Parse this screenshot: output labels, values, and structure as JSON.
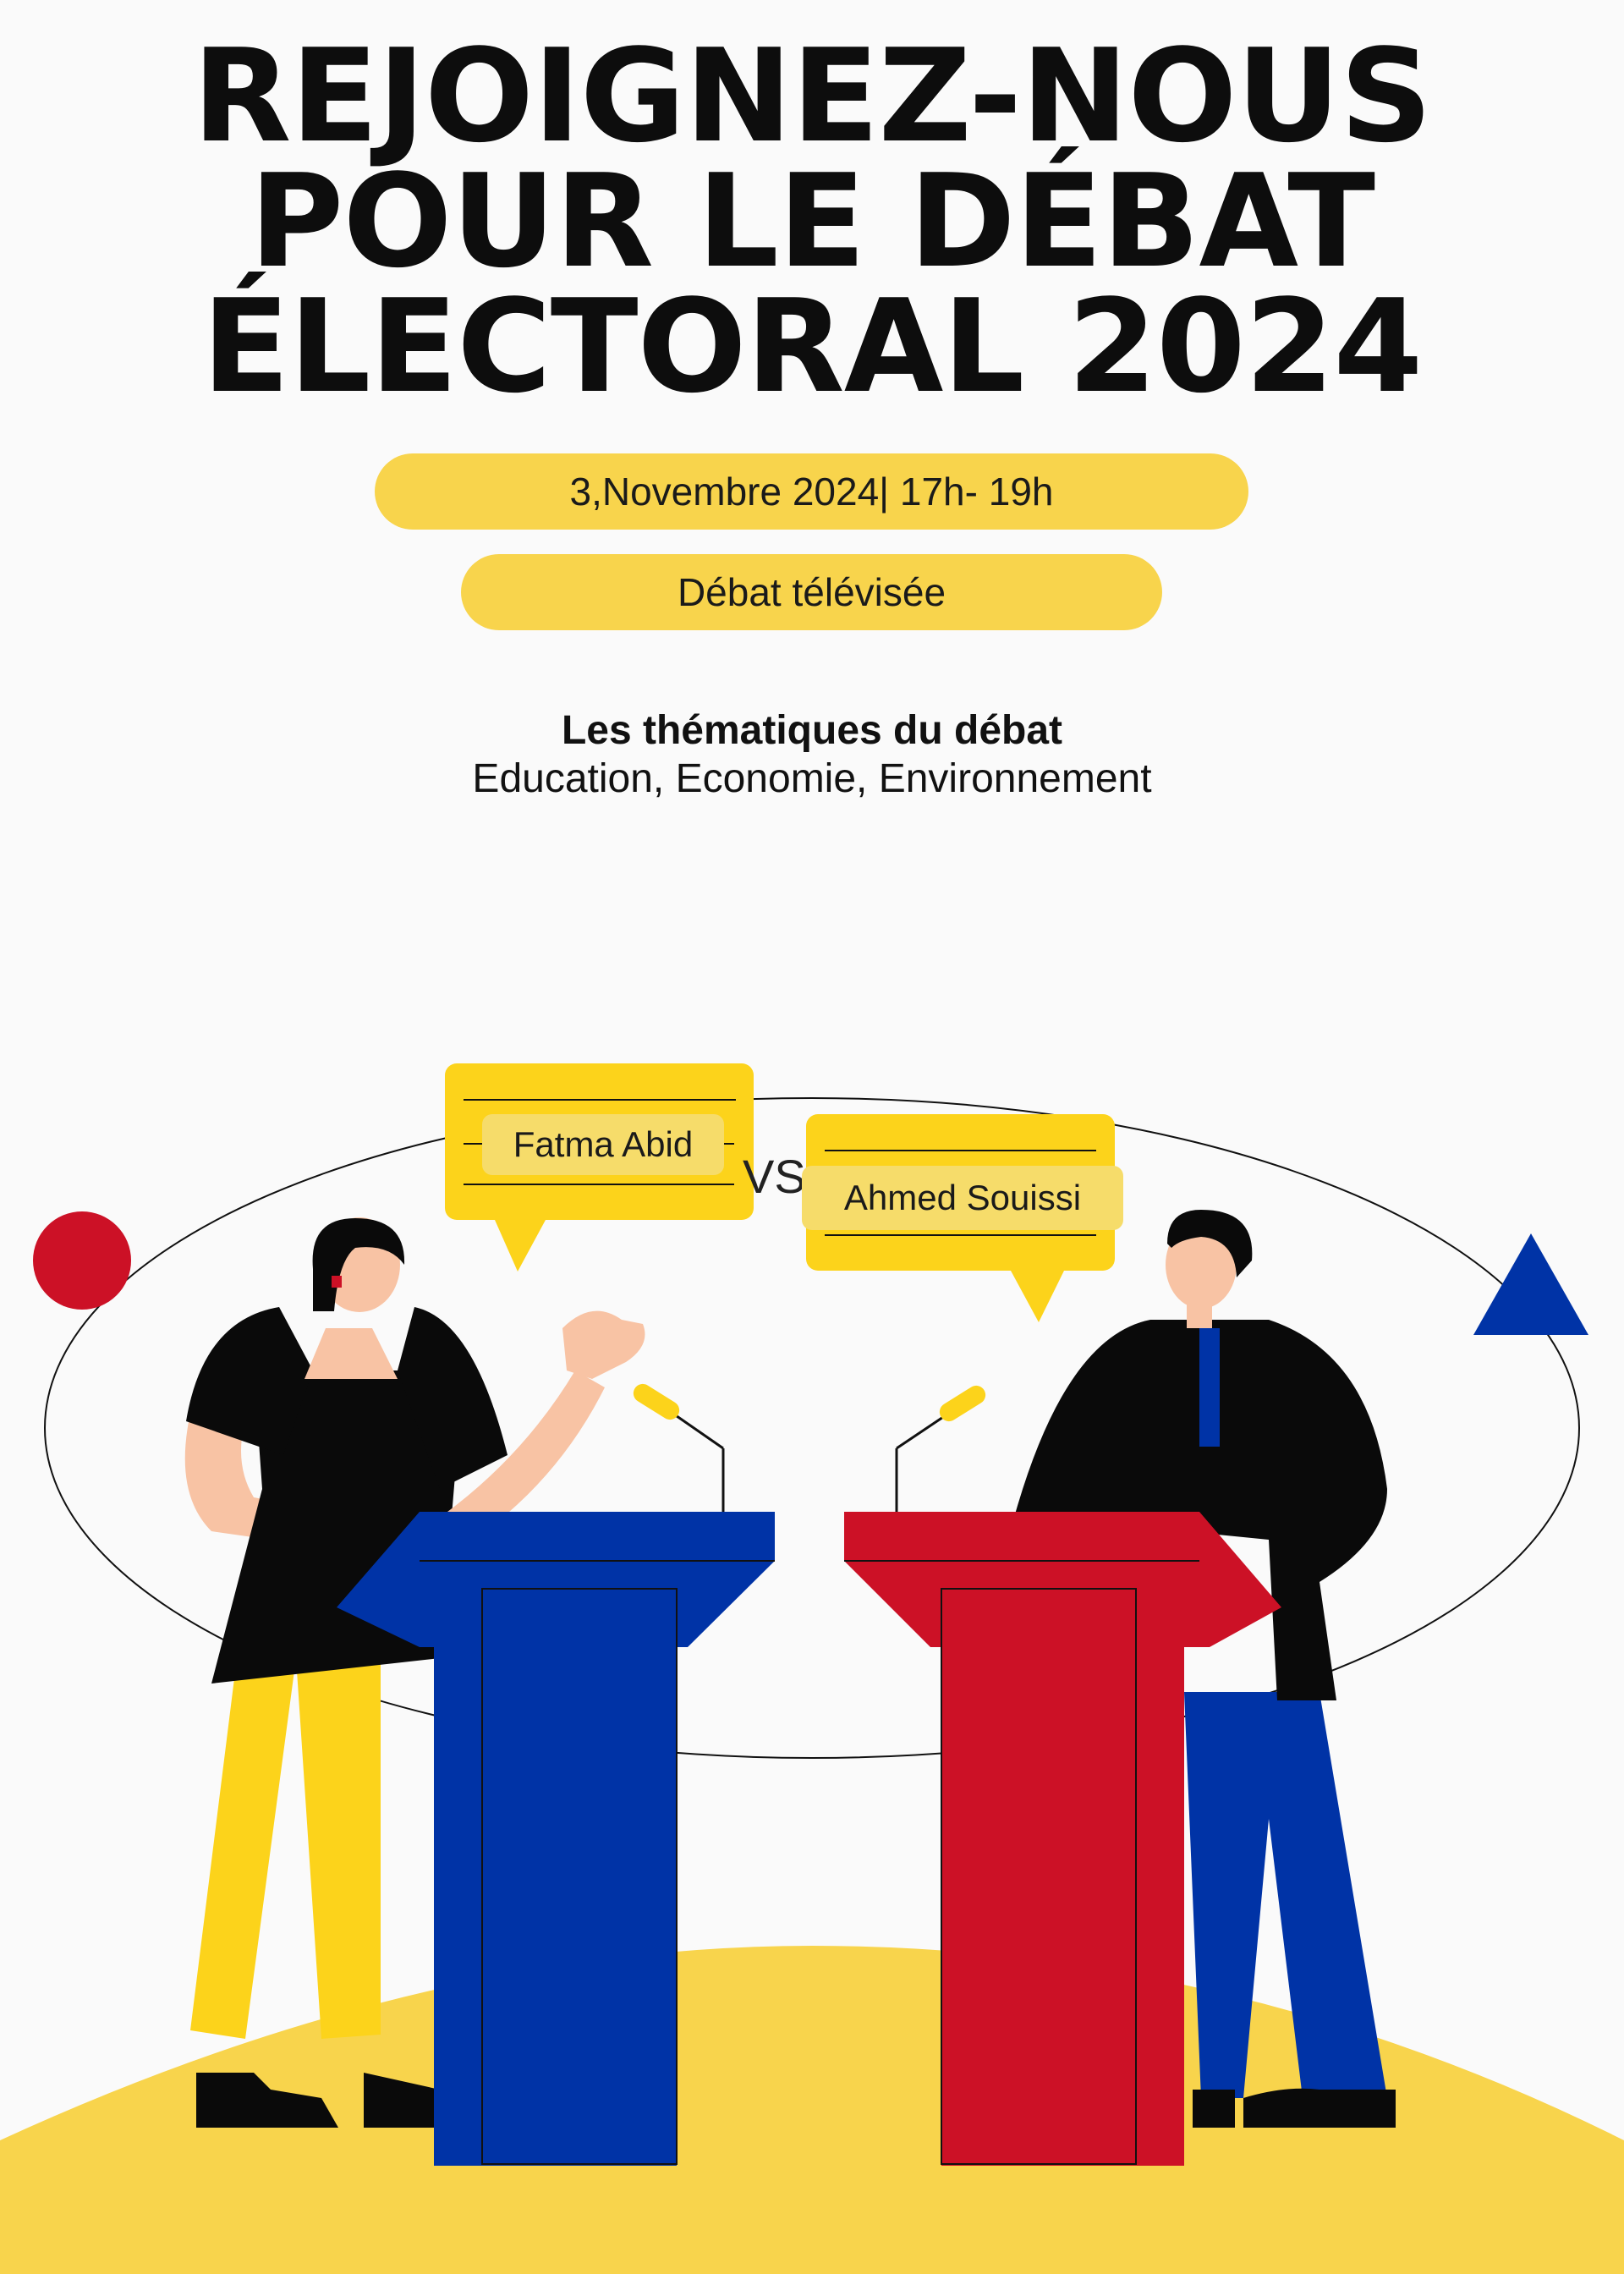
{
  "poster": {
    "title": "REJOIGNEZ-NOUS POUR LE DÉBAT ÉLECTORAL 2024",
    "date_time": "3,Novembre  2024| 17h- 19h",
    "event_type": "Débat télévisée",
    "themes_heading": "Les  thématiques du débat",
    "themes_list": "Education, Economie, Environnement"
  },
  "debate": {
    "candidate_left": "Fatma Abid",
    "versus": "VS",
    "candidate_right": "Ahmed  Souissi"
  },
  "colors": {
    "background": "#fafafa",
    "accent_yellow": "#f8d44c",
    "bubble_yellow": "#fcd31b",
    "blue": "#0033a6",
    "red": "#cc1126",
    "black": "#0a0a0a",
    "skin": "#f8c3a4"
  },
  "icons": [
    "red-circle-icon",
    "blue-triangle-icon",
    "microphone-icon"
  ]
}
